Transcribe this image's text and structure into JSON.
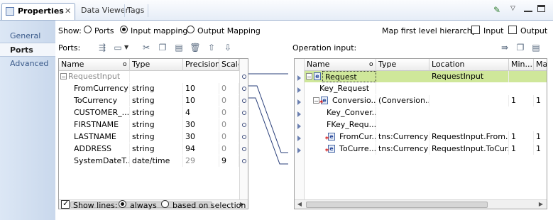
{
  "tabs": [
    {
      "label": "Properties",
      "active": true,
      "closable": true
    },
    {
      "label": "Data Viewer",
      "active": false
    },
    {
      "label": "Tags",
      "active": false
    }
  ],
  "window_icons": [
    "pin-icon",
    "view-menu-icon",
    "minimize-icon",
    "maximize-icon"
  ],
  "nav": [
    {
      "label": "General",
      "active": false
    },
    {
      "label": "Ports",
      "active": true
    },
    {
      "label": "Advanced",
      "active": false
    }
  ],
  "show": {
    "label": "Show:",
    "options": [
      {
        "label": "Ports",
        "selected": false
      },
      {
        "label": "Input mapping",
        "selected": true
      },
      {
        "label": "Output Mapping",
        "selected": false
      }
    ]
  },
  "map_hierarchy": {
    "label": "Map first level hierarchy:",
    "input": {
      "label": "Input",
      "checked": false
    },
    "output": {
      "label": "Output",
      "checked": false
    }
  },
  "ports": {
    "label": "Ports:",
    "columns": [
      "Name",
      "Type",
      "Precision",
      "Scale"
    ],
    "rows": [
      {
        "name": "RequestInput",
        "type": "",
        "precision": "",
        "scale": "",
        "group": true
      },
      {
        "name": "FromCurrency",
        "type": "string",
        "precision": "10",
        "scale": "0"
      },
      {
        "name": "ToCurrency",
        "type": "string",
        "precision": "10",
        "scale": "0"
      },
      {
        "name": "CUSTOMER_...",
        "type": "string",
        "precision": "4",
        "scale": "0"
      },
      {
        "name": "FIRSTNAME",
        "type": "string",
        "precision": "30",
        "scale": "0"
      },
      {
        "name": "LASTNAME",
        "type": "string",
        "precision": "30",
        "scale": "0"
      },
      {
        "name": "ADDRESS",
        "type": "string",
        "precision": "94",
        "scale": "0"
      },
      {
        "name": "SystemDateT...",
        "type": "date/time",
        "precision": "29",
        "scale": "9"
      }
    ]
  },
  "operation": {
    "label": "Operation input:",
    "columns": [
      "Name",
      "Type",
      "Location",
      "Min...",
      "Max..."
    ],
    "rows": [
      {
        "name": "Request",
        "type": "",
        "location": "RequestInput",
        "min": "",
        "max": "",
        "highlight": true
      },
      {
        "name": "Key_Request",
        "type": "",
        "location": "",
        "min": "",
        "max": ""
      },
      {
        "name": "Conversio...",
        "type": "(Conversion...",
        "location": "",
        "min": "1",
        "max": "1"
      },
      {
        "name": "Key_Conver...",
        "type": "",
        "location": "",
        "min": "",
        "max": ""
      },
      {
        "name": "FKey_Requ...",
        "type": "",
        "location": "",
        "min": "",
        "max": ""
      },
      {
        "name": "FromCur...",
        "type": "tns:Currency",
        "location": "RequestInput.From...",
        "min": "1",
        "max": "1"
      },
      {
        "name": "ToCurre...",
        "type": "tns:Currency",
        "location": "RequestInput.ToCur...",
        "min": "1",
        "max": "1"
      }
    ]
  },
  "show_lines": {
    "label": "Show lines:",
    "checked": true,
    "options": [
      {
        "label": "always",
        "selected": true
      },
      {
        "label": "based on selection",
        "selected": false
      }
    ]
  },
  "colors": {
    "highlight": "#cfe79a",
    "nav_bg": "#c9d8ec",
    "link_line": "#2a3f7a"
  }
}
